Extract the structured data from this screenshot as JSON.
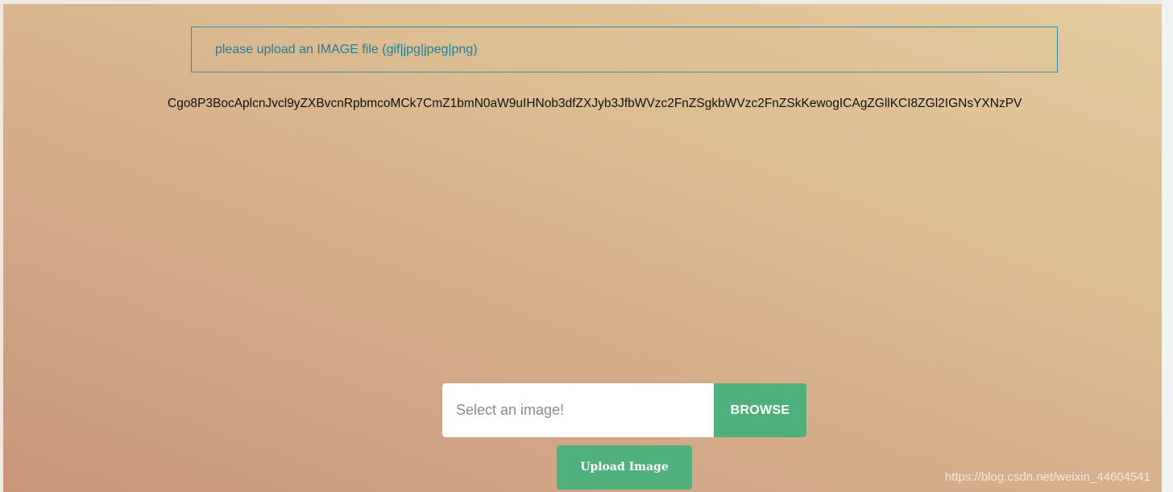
{
  "alert": {
    "message": "please upload an IMAGE file (gif|jpg|jpeg|png)"
  },
  "encoded_output": {
    "text": "Cgo8P3BocAplcnJvcl9yZXBvcnRpbmcoMCk7CmZ1bmN0aW9uIHNob3dfZXJyb3JfbWVzc2FnZSgkbWVzc2FnZSkKewogICAgZGllKCI8ZGl2IGNsYXNzPV"
  },
  "upload_form": {
    "file_placeholder": "Select an image!",
    "browse_label": "BROWSE",
    "submit_label": "Upload Image"
  },
  "watermark": {
    "text": "https://blog.csdn.net/weixin_44604541"
  },
  "colors": {
    "accent_green": "#4fb07c",
    "alert_blue": "#1e7f9c"
  }
}
